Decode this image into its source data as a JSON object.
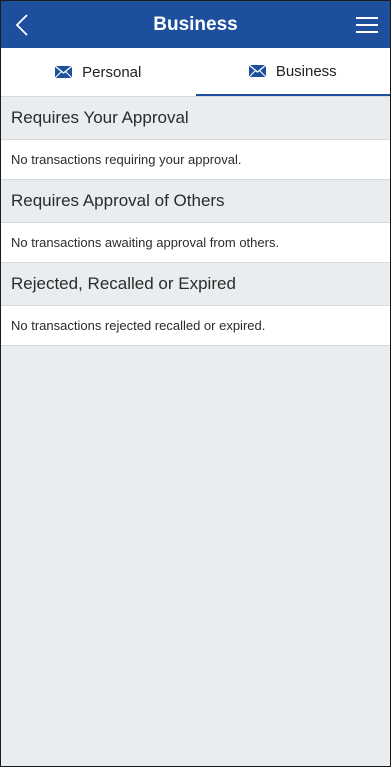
{
  "header": {
    "title": "Business",
    "back_icon": "chevron-left-icon",
    "menu_icon": "hamburger-menu-icon",
    "background_color": "#1d4f9c"
  },
  "tabs": [
    {
      "label": "Personal",
      "icon": "envelope-icon",
      "active": false
    },
    {
      "label": "Business",
      "icon": "envelope-icon",
      "active": true
    }
  ],
  "sections": [
    {
      "title": "Requires Your Approval",
      "message": "No transactions requiring your approval."
    },
    {
      "title": "Requires Approval of Others",
      "message": "No transactions awaiting approval from others."
    },
    {
      "title": "Rejected, Recalled or Expired",
      "message": "No transactions rejected recalled or expired."
    }
  ]
}
